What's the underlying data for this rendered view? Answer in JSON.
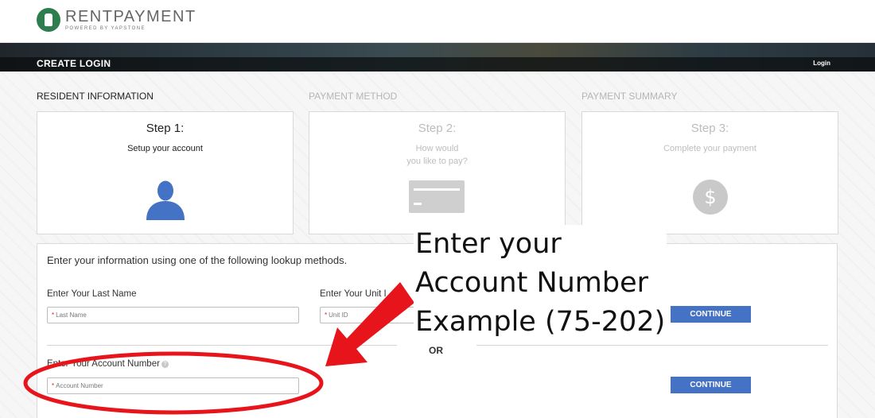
{
  "header": {
    "logo_name": "RENTPAYMENT",
    "logo_tagline": "POWERED BY YAPSTONE"
  },
  "banner": {
    "title": "CREATE LOGIN",
    "login_link": "Login"
  },
  "steps": [
    {
      "section_label": "RESIDENT INFORMATION",
      "step": "Step 1:",
      "description": "Setup your account",
      "icon": "user-icon",
      "active": true
    },
    {
      "section_label": "PAYMENT METHOD",
      "step": "Step 2:",
      "description_line1": "How would",
      "description_line2": "you like to pay?",
      "icon": "credit-card-icon",
      "active": false
    },
    {
      "section_label": "PAYMENT SUMMARY",
      "step": "Step 3:",
      "description": "Complete your payment",
      "icon": "dollar-icon",
      "active": false
    }
  ],
  "form": {
    "intro": "Enter your information using one of the following lookup methods.",
    "last_name_label": "Enter Your Last Name",
    "last_name_placeholder": "Last Name",
    "unit_label": "Enter Your Unit I",
    "unit_placeholder": "Unit ID",
    "continue_label": "CONTINUE",
    "or_label": "OR",
    "account_label": "Enter Your Account Number",
    "help_glyph": "?",
    "account_placeholder": "Account Number",
    "required_mark": "*"
  },
  "annotation": {
    "line1": "Enter your",
    "line2": "Account Number",
    "line3": "Example (75-202)",
    "color": "#e8141b"
  },
  "colors": {
    "button_blue": "#4472c4",
    "user_icon_blue": "#4472c4",
    "logo_green": "#2e7d4f"
  }
}
